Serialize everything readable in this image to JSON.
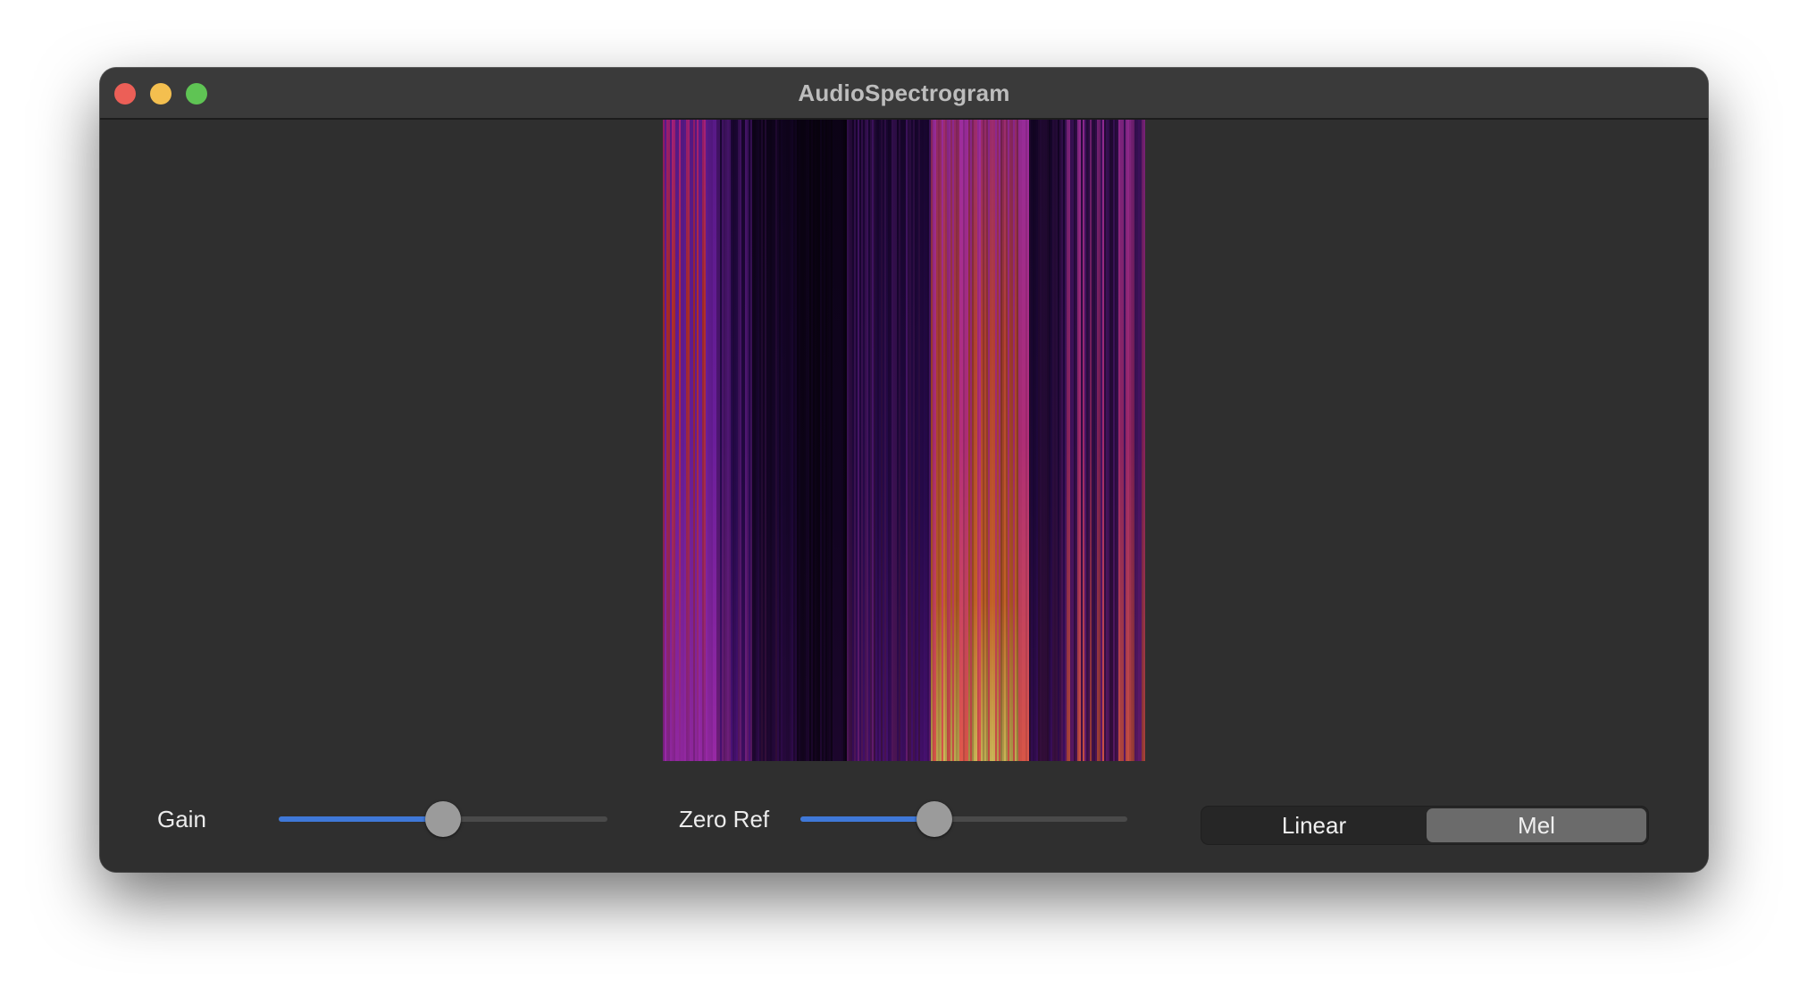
{
  "window": {
    "title": "AudioSpectrogram",
    "traffic_lights": [
      "close",
      "minimize",
      "zoom"
    ]
  },
  "spectrogram": {
    "colormap": "magma",
    "colors": [
      "#000000",
      "#3b0f70",
      "#8c2981",
      "#de4968",
      "#fe9f6d",
      "#fcfdbf"
    ]
  },
  "controls": {
    "gain": {
      "label": "Gain",
      "value_fraction": 0.5
    },
    "zero_ref": {
      "label": "Zero Ref",
      "value_fraction": 0.41
    },
    "scale_mode": {
      "options": [
        "Linear",
        "Mel"
      ],
      "selected": "Mel"
    }
  }
}
